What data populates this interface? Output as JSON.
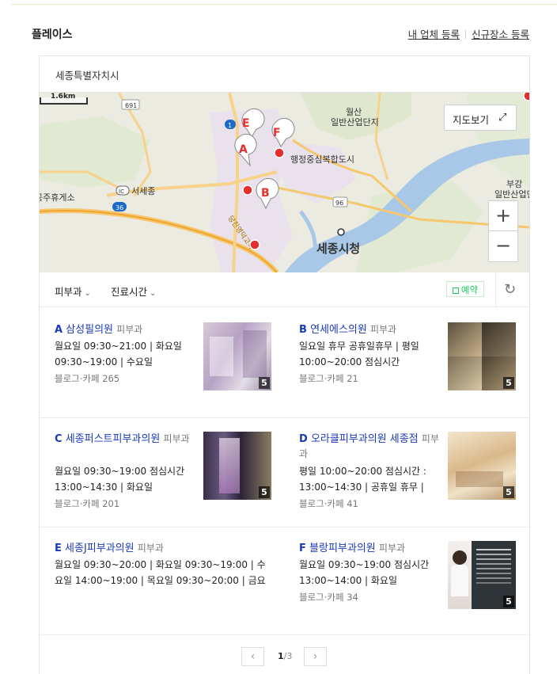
{
  "header": {
    "title": "플레이스",
    "link_register_business": "내 업체 등록",
    "link_register_new_place": "신규장소 등록"
  },
  "region": "세종특별자치시",
  "map": {
    "scale_label": "1.6km",
    "map_view_button": "지도보기",
    "zoom_in": "+",
    "zoom_out": "−",
    "labels": {
      "wolsan": "월산",
      "wolsan2": "일반산업단지",
      "admin_city": "행정중심복합도시",
      "seojong": "서세종",
      "rest_area": "공주휴게소",
      "sejong_city_hall": "세종시청",
      "bugang": "부강",
      "bugang2": "일반산업단",
      "road_691": "691",
      "road_36": "36",
      "road_1": "1",
      "road_96": "96",
      "ic": "IC",
      "dangjin": "당진영덕고속"
    },
    "markers": [
      "A",
      "B",
      "E",
      "F"
    ]
  },
  "filters": {
    "category": "피부과",
    "hours": "진료시간",
    "reserve": "예약"
  },
  "places": [
    {
      "letter": "A",
      "name": "삼성필의원",
      "category": "피부과",
      "info": "월요일 09:30~21:00 | 화요일 09:30~19:00 | 수요일",
      "blog": "블로그·카페 265",
      "photos": "5"
    },
    {
      "letter": "B",
      "name": "연세에스의원",
      "category": "피부과",
      "info": "일요일 휴무 공휴일휴무 | 평일 10:00~20:00 점심시간",
      "blog": "블로그·카페 21",
      "photos": "5"
    },
    {
      "letter": "C",
      "name": "세종퍼스트피부과의원",
      "category": "피부과",
      "info": "월요일 09:30~19:00 점심시간 13:00~14:30 | 화요일",
      "blog": "블로그·카페 201",
      "photos": "5"
    },
    {
      "letter": "D",
      "name": "오라클피부과의원 세종점",
      "category": "피부과",
      "info": "평일 10:00~20:00 점심시간 : 13:00~14:30 | 공휴일 휴무 |",
      "blog": "블로그·카페 41",
      "photos": "5"
    },
    {
      "letter": "E",
      "name": "세종J피부과의원",
      "category": "피부과",
      "info": "월요일 09:30~20:00 | 화요일 09:30~19:00 | 수요일 14:00~19:00 | 목요일 09:30~20:00 | 금요",
      "blog": "",
      "photos": ""
    },
    {
      "letter": "F",
      "name": "블랑피부과의원",
      "category": "피부과",
      "info": "월요일 09:30~19:00 점심시간 13:00~14:00 | 화요일",
      "blog": "블로그·카페 34",
      "photos": "5"
    }
  ],
  "pagination": {
    "current": "1",
    "total": "/3",
    "prev": "‹",
    "next": "›"
  }
}
